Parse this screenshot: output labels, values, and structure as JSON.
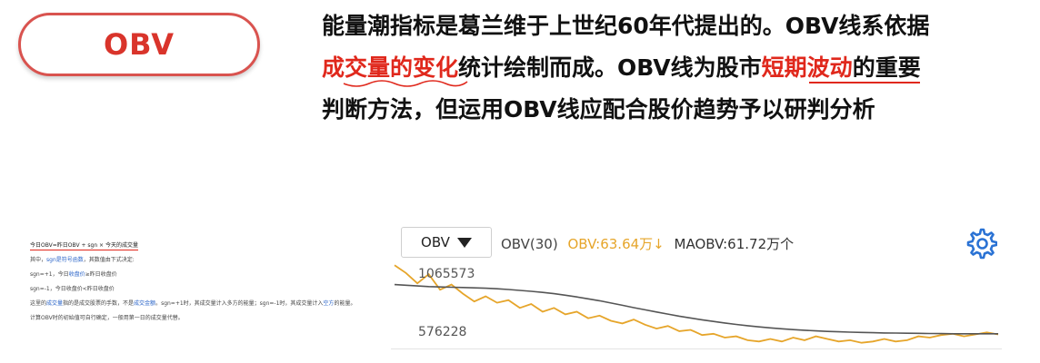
{
  "badge": {
    "label": "OBV"
  },
  "headline": {
    "line1": "能量潮指标是葛兰维于上世纪60年代提出的。OBV线系依据",
    "line2_emph": "成交量的变化",
    "line2_rest": "统计绘制而成。OBV线为股市",
    "line2_emph2": "短期波动",
    "line2_end": "的重要",
    "line3": "判断方法，但运用OBV线应配合股价趋势予以研判分析"
  },
  "doc": {
    "formula": "今日OBV=昨日OBV + sgn × 今天的成交量",
    "note_prefix": "其中，",
    "note_link": "sgn是符号函数",
    "note_suffix": "，其数值由下式决定:",
    "case1_prefix": "sgn=+1，今日",
    "case1_link": "收盘价",
    "case1_suffix": "≥昨日收盘价",
    "case2": "sgn=-1，今日收盘价<昨日收盘价",
    "para_prefix": "这里的",
    "para_link1": "成交量",
    "para_mid": "指的是成交股票的手数，不是",
    "para_link2": "成交金额",
    "para_rest": "。sgn=+1时，其成交量计入多方的能量；sgn=-1时，其成交量计入",
    "para_link3": "空方",
    "para_end": "的能量。",
    "final": "计算OBV时的初始值可自行确定，一般用第一日的成交量代替。"
  },
  "toolbar": {
    "select_label": "OBV",
    "param": "OBV(30)",
    "obv_value": "OBV:63.64万↓",
    "maobv_value": "MAOBV:61.72万个",
    "settings_icon": "gear-icon"
  },
  "chart_data": {
    "type": "line",
    "yticks": [
      "1065573",
      "576228"
    ],
    "ylim": [
      520000,
      1180000
    ],
    "colors": {
      "OBV": "#e6a52a",
      "MAOBV": "#555555"
    },
    "series": [
      {
        "name": "OBV",
        "values": [
          1150000,
          1090000,
          1010000,
          1080000,
          960000,
          1000000,
          930000,
          870000,
          910000,
          860000,
          880000,
          820000,
          850000,
          790000,
          820000,
          770000,
          790000,
          740000,
          760000,
          720000,
          700000,
          730000,
          690000,
          660000,
          680000,
          640000,
          650000,
          610000,
          620000,
          590000,
          600000,
          570000,
          560000,
          580000,
          560000,
          590000,
          570000,
          600000,
          580000,
          560000,
          570000,
          550000,
          560000,
          580000,
          560000,
          570000,
          600000,
          590000,
          610000,
          620000,
          600000,
          615000,
          630000,
          615000
        ]
      },
      {
        "name": "MAOBV",
        "values": [
          1000000,
          995000,
          990000,
          985000,
          982000,
          980000,
          978000,
          975000,
          972000,
          968000,
          962000,
          955000,
          948000,
          940000,
          930000,
          918000,
          905000,
          890000,
          875000,
          858000,
          840000,
          822000,
          805000,
          788000,
          772000,
          756000,
          742000,
          728000,
          715000,
          703000,
          692000,
          682000,
          673000,
          665000,
          658000,
          652000,
          647000,
          642000,
          638000,
          635000,
          632000,
          630000,
          628000,
          626000,
          625000,
          624000,
          623000,
          622000,
          621000,
          620000,
          620000,
          620000,
          620000,
          620000
        ]
      }
    ]
  }
}
